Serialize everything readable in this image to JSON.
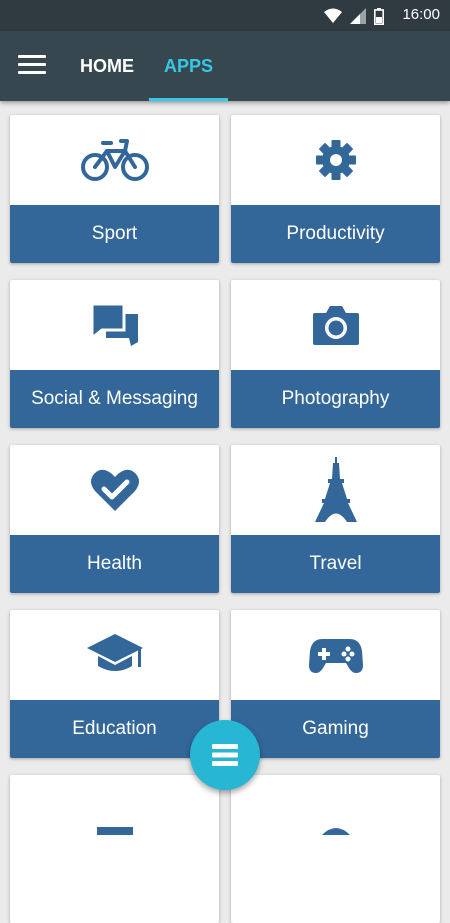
{
  "status_bar": {
    "time": "16:00"
  },
  "nav": {
    "tabs": [
      {
        "label": "HOME"
      },
      {
        "label": "APPS"
      }
    ]
  },
  "categories": [
    {
      "label": "Sport",
      "icon": "bicycle-icon"
    },
    {
      "label": "Productivity",
      "icon": "gear-icon"
    },
    {
      "label": "Social & Messaging",
      "icon": "chat-icon"
    },
    {
      "label": "Photography",
      "icon": "camera-icon"
    },
    {
      "label": "Health",
      "icon": "heart-check-icon"
    },
    {
      "label": "Travel",
      "icon": "eiffel-tower-icon"
    },
    {
      "label": "Education",
      "icon": "graduation-cap-icon"
    },
    {
      "label": "Gaming",
      "icon": "gamepad-icon"
    }
  ],
  "colors": {
    "accent": "#35c9e6",
    "card_label_bg": "#336699",
    "app_bar": "#37474f",
    "fab": "#27b6d4"
  }
}
